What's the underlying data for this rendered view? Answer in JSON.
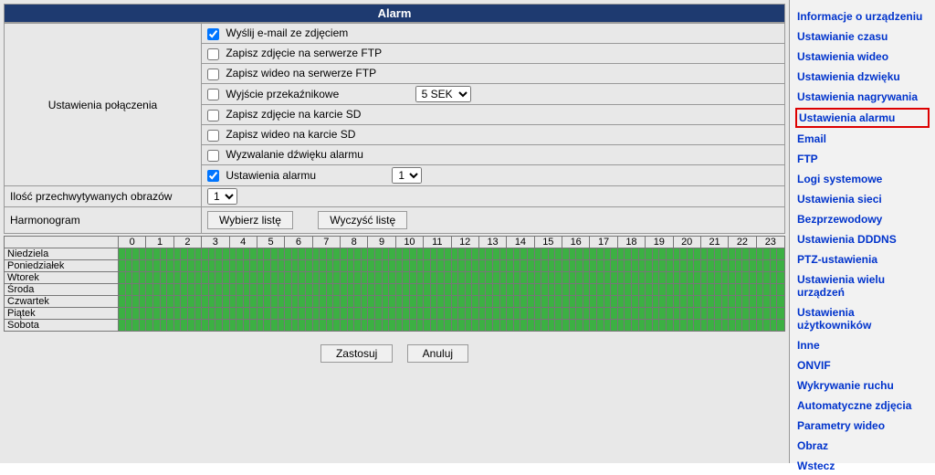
{
  "panel_title": "Alarm",
  "connection": {
    "label": "Ustawienia połączenia",
    "email": "Wyślij e-mail ze zdjęciem",
    "ftp_photo": "Zapisz zdjęcie na serwerze FTP",
    "ftp_video": "Zapisz wideo na serwerze FTP",
    "relay": "Wyjście przekaźnikowe",
    "relay_value": "5 SEK",
    "sd_photo": "Zapisz zdjęcie na karcie SD",
    "sd_video": "Zapisz wideo na karcie SD",
    "sound": "Wyzwalanie dźwięku alarmu",
    "alarm_settings": "Ustawienia alarmu",
    "alarm_value": "1"
  },
  "captured": {
    "label": "Ilość przechwytywanych obrazów",
    "value": "1"
  },
  "schedule": {
    "label": "Harmonogram",
    "select_btn": "Wybierz listę",
    "clear_btn": "Wyczyść listę",
    "hours": [
      "0",
      "1",
      "2",
      "3",
      "4",
      "5",
      "6",
      "7",
      "8",
      "9",
      "10",
      "11",
      "12",
      "13",
      "14",
      "15",
      "16",
      "17",
      "18",
      "19",
      "20",
      "21",
      "22",
      "23"
    ],
    "days": [
      "Niedziela",
      "Poniedziałek",
      "Wtorek",
      "Środa",
      "Czwartek",
      "Piątek",
      "Sobota"
    ]
  },
  "buttons": {
    "apply": "Zastosuj",
    "cancel": "Anuluj"
  },
  "nav": {
    "items": [
      "Informacje o urządzeniu",
      "Ustawianie czasu",
      "Ustawienia wideo",
      "Ustawienia dzwięku",
      "Ustawienia nagrywania",
      "Ustawienia alarmu",
      "Email",
      "FTP",
      "Logi systemowe",
      "Ustawienia sieci",
      "Bezprzewodowy",
      "Ustawienia DDDNS",
      "PTZ-ustawienia",
      "Ustawienia wielu urządzeń",
      "Ustawienia użytkowników",
      "Inne",
      "ONVIF",
      "Wykrywanie ruchu",
      "Automatyczne zdjęcia",
      "Parametry wideo",
      "Obraz",
      "Wstecz"
    ],
    "active_index": 5
  }
}
